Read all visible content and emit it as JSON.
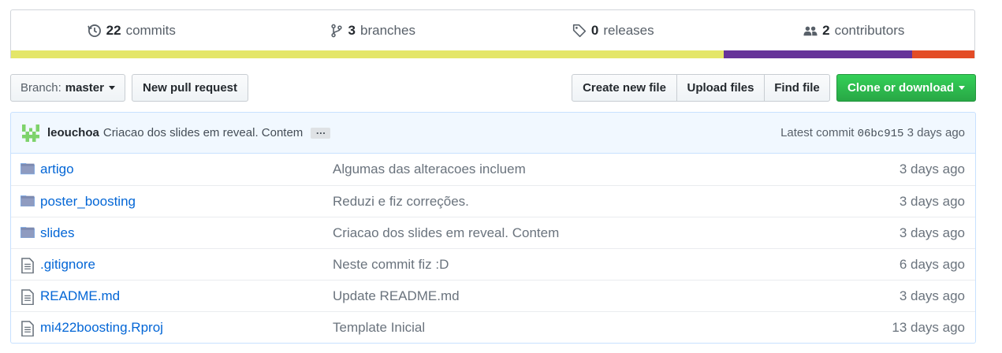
{
  "summary": {
    "commits": {
      "count": "22",
      "label": "commits",
      "icon": "history-icon"
    },
    "branches": {
      "count": "3",
      "label": "branches",
      "icon": "git-branch-icon"
    },
    "releases": {
      "count": "0",
      "label": "releases",
      "icon": "tag-icon"
    },
    "contributors": {
      "count": "2",
      "label": "contributors",
      "icon": "people-icon"
    },
    "language_bar": [
      {
        "color": "#e4e669",
        "share": 0.74
      },
      {
        "color": "#663399",
        "share": 0.195
      },
      {
        "color": "#e34c26",
        "share": 0.065
      }
    ]
  },
  "toolbar": {
    "branch_prefix": "Branch:",
    "branch_name": "master",
    "new_pull_request": "New pull request",
    "create_new_file": "Create new file",
    "upload_files": "Upload files",
    "find_file": "Find file",
    "clone_or_download": "Clone or download"
  },
  "commit": {
    "author": "leouchoa",
    "message": "Criacao dos slides em reveal. Contem",
    "ellipsis": "…",
    "latest_label": "Latest commit",
    "sha": "06bc915",
    "age": "3 days ago"
  },
  "files": [
    {
      "name": "artigo",
      "type": "folder",
      "message": "Algumas das alteracoes incluem",
      "age": "3 days ago"
    },
    {
      "name": "poster_boosting",
      "type": "folder",
      "message": "Reduzi e fiz correções.",
      "age": "3 days ago"
    },
    {
      "name": "slides",
      "type": "folder",
      "message": "Criacao dos slides em reveal. Contem",
      "age": "3 days ago"
    },
    {
      "name": ".gitignore",
      "type": "file",
      "message": "Neste commit fiz :D",
      "age": "6 days ago"
    },
    {
      "name": "README.md",
      "type": "file",
      "message": "Update README.md",
      "age": "3 days ago"
    },
    {
      "name": "mi422boosting.Rproj",
      "type": "file",
      "message": "Template Inicial",
      "age": "13 days ago"
    }
  ]
}
